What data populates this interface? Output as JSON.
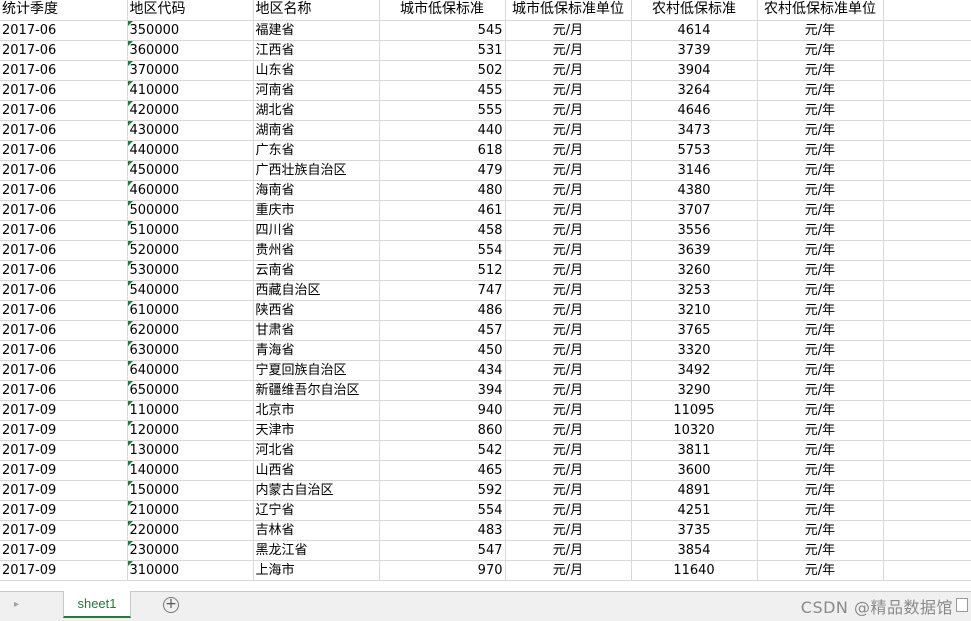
{
  "headers": [
    "统计季度",
    "地区代码",
    "地区名称",
    "城市低保标准",
    "城市低保标准单位",
    "农村低保标准",
    "农村低保标准单位",
    ""
  ],
  "rows": [
    [
      "2017-06",
      "350000",
      "福建省",
      "545",
      "元/月",
      "4614",
      "元/年"
    ],
    [
      "2017-06",
      "360000",
      "江西省",
      "531",
      "元/月",
      "3739",
      "元/年"
    ],
    [
      "2017-06",
      "370000",
      "山东省",
      "502",
      "元/月",
      "3904",
      "元/年"
    ],
    [
      "2017-06",
      "410000",
      "河南省",
      "455",
      "元/月",
      "3264",
      "元/年"
    ],
    [
      "2017-06",
      "420000",
      "湖北省",
      "555",
      "元/月",
      "4646",
      "元/年"
    ],
    [
      "2017-06",
      "430000",
      "湖南省",
      "440",
      "元/月",
      "3473",
      "元/年"
    ],
    [
      "2017-06",
      "440000",
      "广东省",
      "618",
      "元/月",
      "5753",
      "元/年"
    ],
    [
      "2017-06",
      "450000",
      "广西壮族自治区",
      "479",
      "元/月",
      "3146",
      "元/年"
    ],
    [
      "2017-06",
      "460000",
      "海南省",
      "480",
      "元/月",
      "4380",
      "元/年"
    ],
    [
      "2017-06",
      "500000",
      "重庆市",
      "461",
      "元/月",
      "3707",
      "元/年"
    ],
    [
      "2017-06",
      "510000",
      "四川省",
      "458",
      "元/月",
      "3556",
      "元/年"
    ],
    [
      "2017-06",
      "520000",
      "贵州省",
      "554",
      "元/月",
      "3639",
      "元/年"
    ],
    [
      "2017-06",
      "530000",
      "云南省",
      "512",
      "元/月",
      "3260",
      "元/年"
    ],
    [
      "2017-06",
      "540000",
      "西藏自治区",
      "747",
      "元/月",
      "3253",
      "元/年"
    ],
    [
      "2017-06",
      "610000",
      "陕西省",
      "486",
      "元/月",
      "3210",
      "元/年"
    ],
    [
      "2017-06",
      "620000",
      "甘肃省",
      "457",
      "元/月",
      "3765",
      "元/年"
    ],
    [
      "2017-06",
      "630000",
      "青海省",
      "450",
      "元/月",
      "3320",
      "元/年"
    ],
    [
      "2017-06",
      "640000",
      "宁夏回族自治区",
      "434",
      "元/月",
      "3492",
      "元/年"
    ],
    [
      "2017-06",
      "650000",
      "新疆维吾尔自治区",
      "394",
      "元/月",
      "3290",
      "元/年"
    ],
    [
      "2017-09",
      "110000",
      "北京市",
      "940",
      "元/月",
      "11095",
      "元/年"
    ],
    [
      "2017-09",
      "120000",
      "天津市",
      "860",
      "元/月",
      "10320",
      "元/年"
    ],
    [
      "2017-09",
      "130000",
      "河北省",
      "542",
      "元/月",
      "3811",
      "元/年"
    ],
    [
      "2017-09",
      "140000",
      "山西省",
      "465",
      "元/月",
      "3600",
      "元/年"
    ],
    [
      "2017-09",
      "150000",
      "内蒙古自治区",
      "592",
      "元/月",
      "4891",
      "元/年"
    ],
    [
      "2017-09",
      "210000",
      "辽宁省",
      "554",
      "元/月",
      "4251",
      "元/年"
    ],
    [
      "2017-09",
      "220000",
      "吉林省",
      "483",
      "元/月",
      "3735",
      "元/年"
    ],
    [
      "2017-09",
      "230000",
      "黑龙江省",
      "547",
      "元/月",
      "3854",
      "元/年"
    ],
    [
      "2017-09",
      "310000",
      "上海市",
      "970",
      "元/月",
      "11640",
      "元/年"
    ]
  ],
  "tabbar": {
    "sheet_tab": "sheet1",
    "add_sheet": "+",
    "watermark": "CSDN @精品数据馆"
  },
  "colors": {
    "accent": "#1f7a3d",
    "gridline": "#d8d8d8"
  }
}
